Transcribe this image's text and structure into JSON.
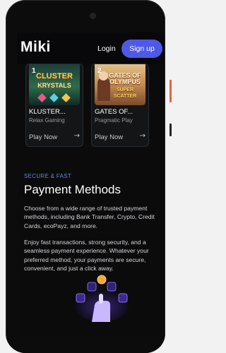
{
  "header": {
    "logo": "Miki",
    "login_label": "Login",
    "signup_label": "Sign up"
  },
  "games": [
    {
      "rank": "1",
      "thumb_title": "CLUSTER",
      "thumb_subtitle": "KRYSTALS",
      "title": "KLUSTER...",
      "provider": "Relax Gaming",
      "play_label": "Play Now",
      "arrow": "→"
    },
    {
      "rank": "2",
      "thumb_title": "GATES OF OLYMPUS",
      "thumb_subtitle": "SUPER SCATTER",
      "title": "GATES OF...",
      "provider": "Pragmatic Play",
      "play_label": "Play Now",
      "arrow": "→"
    }
  ],
  "payments": {
    "eyebrow": "SECURE & FAST",
    "heading": "Payment Methods",
    "paragraph1": "Choose from a wide range of trusted payment methods, including Bank Transfer, Crypto, Credit Cards, ecoPayz, and more.",
    "paragraph2": "Enjoy fast transactions, strong security, and a seamless payment experience. Whatever your preferred method, your payments are secure, convenient, and just a click away."
  },
  "colors": {
    "accent": "#4f59e6",
    "eyebrow": "#6f7fe8",
    "side_button": "#e6652f"
  },
  "icons": [
    "camera-icon",
    "arrow-right-icon",
    "coin-icon",
    "hand-icon"
  ]
}
